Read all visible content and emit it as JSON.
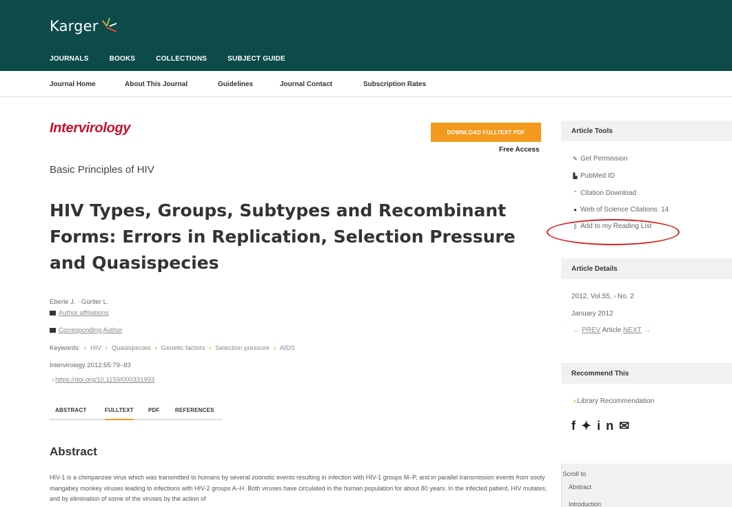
{
  "header": {
    "brand": "Karger",
    "nav": [
      "JOURNALS",
      "BOOKS",
      "COLLECTIONS",
      "SUBJECT GUIDE"
    ]
  },
  "subnav": [
    "Journal Home",
    "About This Journal",
    "Guidelines",
    "Journal Contact",
    "Subscription Rates"
  ],
  "article": {
    "journal": "Intervirology",
    "download_label": "DOWNLOAD FULLTEXT PDF",
    "access": "Free Access",
    "category": "Basic Principles of HIV",
    "title": "HIV Types, Groups, Subtypes and Recombinant Forms: Errors in Replication, Selection Pressure and Quasispecies",
    "authors": "Eberle J. · Gürtler L.",
    "affiliations": "Author affiliations",
    "corresponding": "Corresponding Author",
    "keywords_label": "Keywords:",
    "keywords": [
      "HIV",
      "Quasispecies",
      "Genetic factors",
      "Selection pressure",
      "AIDS"
    ],
    "citation": "Intervirology 2012;55:79–83",
    "doi": "https://doi.org/10.1159/000331993",
    "tabs": [
      "ABSTRACT",
      "FULLTEXT",
      "PDF",
      "REFERENCES"
    ],
    "abstract_heading": "Abstract",
    "abstract_text": "HIV-1 is a chimpanzee virus which was transmitted to humans by several zoonotic events resulting in infection with HIV-1 groups M–P, and in parallel transmission events from sooty mangabey monkey viruses leading to infections with HIV-2 groups A–H. Both viruses have circulated in the human population for about 80 years. In the infected patient, HIV mutates, and by elimination of some of the viruses by the action of"
  },
  "sidebar": {
    "tools_heading": "Article Tools",
    "tools": [
      "Get Permission",
      "PubMed ID",
      "Citation Download",
      "Web of Science Citations: 14",
      "Add to my Reading List"
    ],
    "details_heading": "Article Details",
    "volume": "2012, Vol.55,",
    "issue": "No. 2",
    "date": "January 2012",
    "prev": "PREV",
    "article_word": "Article",
    "next": "NEXT",
    "recommend_heading": "Recommend This",
    "library": "Library Recommendation",
    "scroll_to": "Scroll to",
    "scroll_items": [
      "Abstract",
      "Introduction"
    ]
  },
  "colors": {
    "header_bg": "#0d4a4a",
    "accent_orange": "#f39a1e",
    "journal_red": "#c8102e",
    "annotation_red": "#d91e1e"
  }
}
